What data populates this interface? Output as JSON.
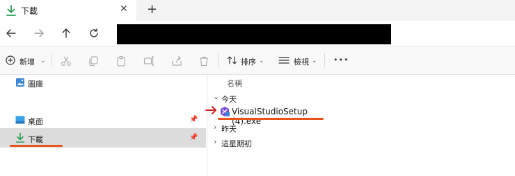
{
  "tab": {
    "title": "下載",
    "close_glyph": "✕",
    "new_tab_glyph": "+"
  },
  "toolbar": {
    "new_label": "新增",
    "sort_label": "排序",
    "view_label": "檢視",
    "more_glyph": "•••"
  },
  "nav": {
    "items": [
      {
        "label": "圖庫"
      },
      {
        "label": "桌面"
      },
      {
        "label": "下載"
      }
    ]
  },
  "content": {
    "column_header": "名稱",
    "groups": [
      {
        "label": "今天",
        "expanded": true
      },
      {
        "label": "昨天",
        "expanded": false
      },
      {
        "label": "這星期初",
        "expanded": false
      }
    ],
    "file": {
      "name": "VisualStudioSetup (4).exe"
    }
  },
  "colors": {
    "accent_green": "#2e9e57",
    "annotation_orange": "#e8541b",
    "annotation_red": "#d62020",
    "vs_purple": "#7b4fd6"
  }
}
